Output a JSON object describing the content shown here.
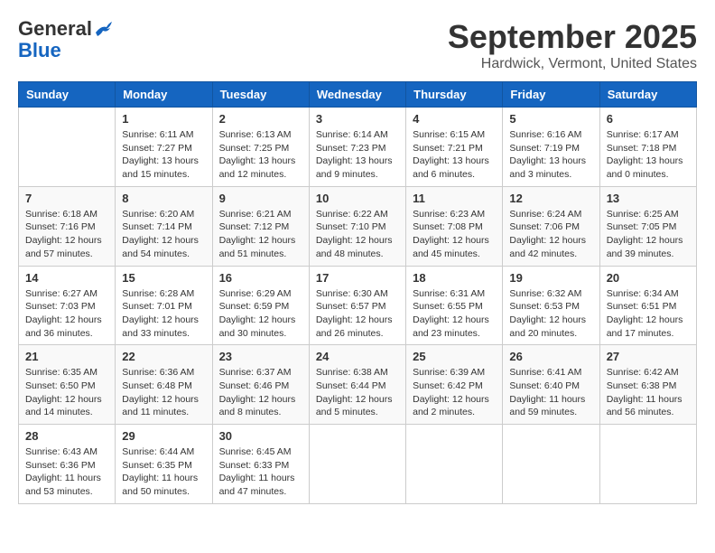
{
  "header": {
    "logo_general": "General",
    "logo_blue": "Blue",
    "month_title": "September 2025",
    "location": "Hardwick, Vermont, United States"
  },
  "days_of_week": [
    "Sunday",
    "Monday",
    "Tuesday",
    "Wednesday",
    "Thursday",
    "Friday",
    "Saturday"
  ],
  "weeks": [
    [
      {
        "day": "",
        "info": ""
      },
      {
        "day": "1",
        "info": "Sunrise: 6:11 AM\nSunset: 7:27 PM\nDaylight: 13 hours\nand 15 minutes."
      },
      {
        "day": "2",
        "info": "Sunrise: 6:13 AM\nSunset: 7:25 PM\nDaylight: 13 hours\nand 12 minutes."
      },
      {
        "day": "3",
        "info": "Sunrise: 6:14 AM\nSunset: 7:23 PM\nDaylight: 13 hours\nand 9 minutes."
      },
      {
        "day": "4",
        "info": "Sunrise: 6:15 AM\nSunset: 7:21 PM\nDaylight: 13 hours\nand 6 minutes."
      },
      {
        "day": "5",
        "info": "Sunrise: 6:16 AM\nSunset: 7:19 PM\nDaylight: 13 hours\nand 3 minutes."
      },
      {
        "day": "6",
        "info": "Sunrise: 6:17 AM\nSunset: 7:18 PM\nDaylight: 13 hours\nand 0 minutes."
      }
    ],
    [
      {
        "day": "7",
        "info": "Sunrise: 6:18 AM\nSunset: 7:16 PM\nDaylight: 12 hours\nand 57 minutes."
      },
      {
        "day": "8",
        "info": "Sunrise: 6:20 AM\nSunset: 7:14 PM\nDaylight: 12 hours\nand 54 minutes."
      },
      {
        "day": "9",
        "info": "Sunrise: 6:21 AM\nSunset: 7:12 PM\nDaylight: 12 hours\nand 51 minutes."
      },
      {
        "day": "10",
        "info": "Sunrise: 6:22 AM\nSunset: 7:10 PM\nDaylight: 12 hours\nand 48 minutes."
      },
      {
        "day": "11",
        "info": "Sunrise: 6:23 AM\nSunset: 7:08 PM\nDaylight: 12 hours\nand 45 minutes."
      },
      {
        "day": "12",
        "info": "Sunrise: 6:24 AM\nSunset: 7:06 PM\nDaylight: 12 hours\nand 42 minutes."
      },
      {
        "day": "13",
        "info": "Sunrise: 6:25 AM\nSunset: 7:05 PM\nDaylight: 12 hours\nand 39 minutes."
      }
    ],
    [
      {
        "day": "14",
        "info": "Sunrise: 6:27 AM\nSunset: 7:03 PM\nDaylight: 12 hours\nand 36 minutes."
      },
      {
        "day": "15",
        "info": "Sunrise: 6:28 AM\nSunset: 7:01 PM\nDaylight: 12 hours\nand 33 minutes."
      },
      {
        "day": "16",
        "info": "Sunrise: 6:29 AM\nSunset: 6:59 PM\nDaylight: 12 hours\nand 30 minutes."
      },
      {
        "day": "17",
        "info": "Sunrise: 6:30 AM\nSunset: 6:57 PM\nDaylight: 12 hours\nand 26 minutes."
      },
      {
        "day": "18",
        "info": "Sunrise: 6:31 AM\nSunset: 6:55 PM\nDaylight: 12 hours\nand 23 minutes."
      },
      {
        "day": "19",
        "info": "Sunrise: 6:32 AM\nSunset: 6:53 PM\nDaylight: 12 hours\nand 20 minutes."
      },
      {
        "day": "20",
        "info": "Sunrise: 6:34 AM\nSunset: 6:51 PM\nDaylight: 12 hours\nand 17 minutes."
      }
    ],
    [
      {
        "day": "21",
        "info": "Sunrise: 6:35 AM\nSunset: 6:50 PM\nDaylight: 12 hours\nand 14 minutes."
      },
      {
        "day": "22",
        "info": "Sunrise: 6:36 AM\nSunset: 6:48 PM\nDaylight: 12 hours\nand 11 minutes."
      },
      {
        "day": "23",
        "info": "Sunrise: 6:37 AM\nSunset: 6:46 PM\nDaylight: 12 hours\nand 8 minutes."
      },
      {
        "day": "24",
        "info": "Sunrise: 6:38 AM\nSunset: 6:44 PM\nDaylight: 12 hours\nand 5 minutes."
      },
      {
        "day": "25",
        "info": "Sunrise: 6:39 AM\nSunset: 6:42 PM\nDaylight: 12 hours\nand 2 minutes."
      },
      {
        "day": "26",
        "info": "Sunrise: 6:41 AM\nSunset: 6:40 PM\nDaylight: 11 hours\nand 59 minutes."
      },
      {
        "day": "27",
        "info": "Sunrise: 6:42 AM\nSunset: 6:38 PM\nDaylight: 11 hours\nand 56 minutes."
      }
    ],
    [
      {
        "day": "28",
        "info": "Sunrise: 6:43 AM\nSunset: 6:36 PM\nDaylight: 11 hours\nand 53 minutes."
      },
      {
        "day": "29",
        "info": "Sunrise: 6:44 AM\nSunset: 6:35 PM\nDaylight: 11 hours\nand 50 minutes."
      },
      {
        "day": "30",
        "info": "Sunrise: 6:45 AM\nSunset: 6:33 PM\nDaylight: 11 hours\nand 47 minutes."
      },
      {
        "day": "",
        "info": ""
      },
      {
        "day": "",
        "info": ""
      },
      {
        "day": "",
        "info": ""
      },
      {
        "day": "",
        "info": ""
      }
    ]
  ]
}
